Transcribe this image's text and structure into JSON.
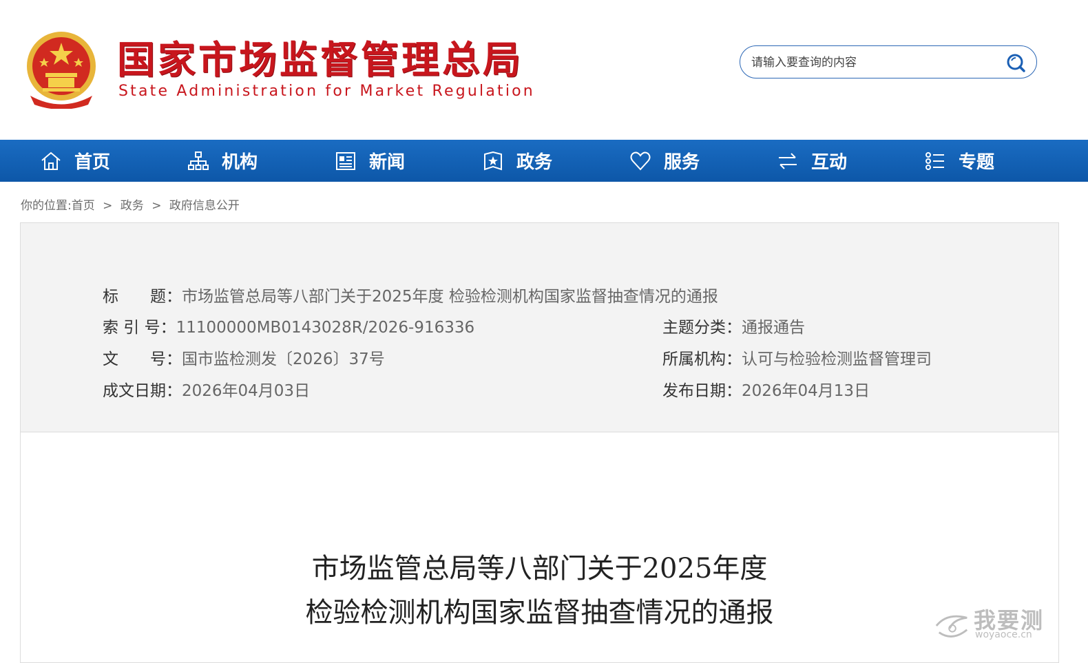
{
  "header": {
    "site_name_cn": "国家市场监督管理总局",
    "site_name_en": "State Administration for Market Regulation",
    "search_placeholder": "请输入要查询的内容"
  },
  "nav": {
    "items": [
      {
        "label": "首页",
        "icon": "home-icon"
      },
      {
        "label": "机构",
        "icon": "org-chart-icon"
      },
      {
        "label": "新闻",
        "icon": "news-icon"
      },
      {
        "label": "政务",
        "icon": "badge-icon"
      },
      {
        "label": "服务",
        "icon": "heart-icon"
      },
      {
        "label": "互动",
        "icon": "exchange-icon"
      },
      {
        "label": "专题",
        "icon": "list-icon"
      }
    ]
  },
  "breadcrumb": {
    "prefix": "你的位置:",
    "items": [
      "首页",
      "政务",
      "政府信息公开"
    ],
    "separator": ">"
  },
  "meta": {
    "title_label": "标　　题：",
    "title_value": "市场监管总局等八部门关于2025年度 检验检测机构国家监督抽查情况的通报",
    "index_label": "索 引 号：",
    "index_value": "11100000MB0143028R/2026-916336",
    "topic_label": "主题分类：",
    "topic_value": "通报通告",
    "docno_label": "文　　号：",
    "docno_value": "国市监检测发〔2026〕37号",
    "org_label": "所属机构：",
    "org_value": "认可与检验检测监督管理司",
    "created_label": "成文日期：",
    "created_value": "2026年04月03日",
    "published_label": "发布日期：",
    "published_value": "2026年04月13日"
  },
  "document": {
    "title_line1": "市场监管总局等八部门关于2025年度",
    "title_line2": "检验检测机构国家监督抽查情况的通报"
  },
  "watermark": {
    "cn": "我要测",
    "en": "woyaoce.cn"
  },
  "colors": {
    "brand_red": "#c8161d",
    "nav_blue": "#1264b8",
    "meta_bg": "#f3f3f3"
  }
}
